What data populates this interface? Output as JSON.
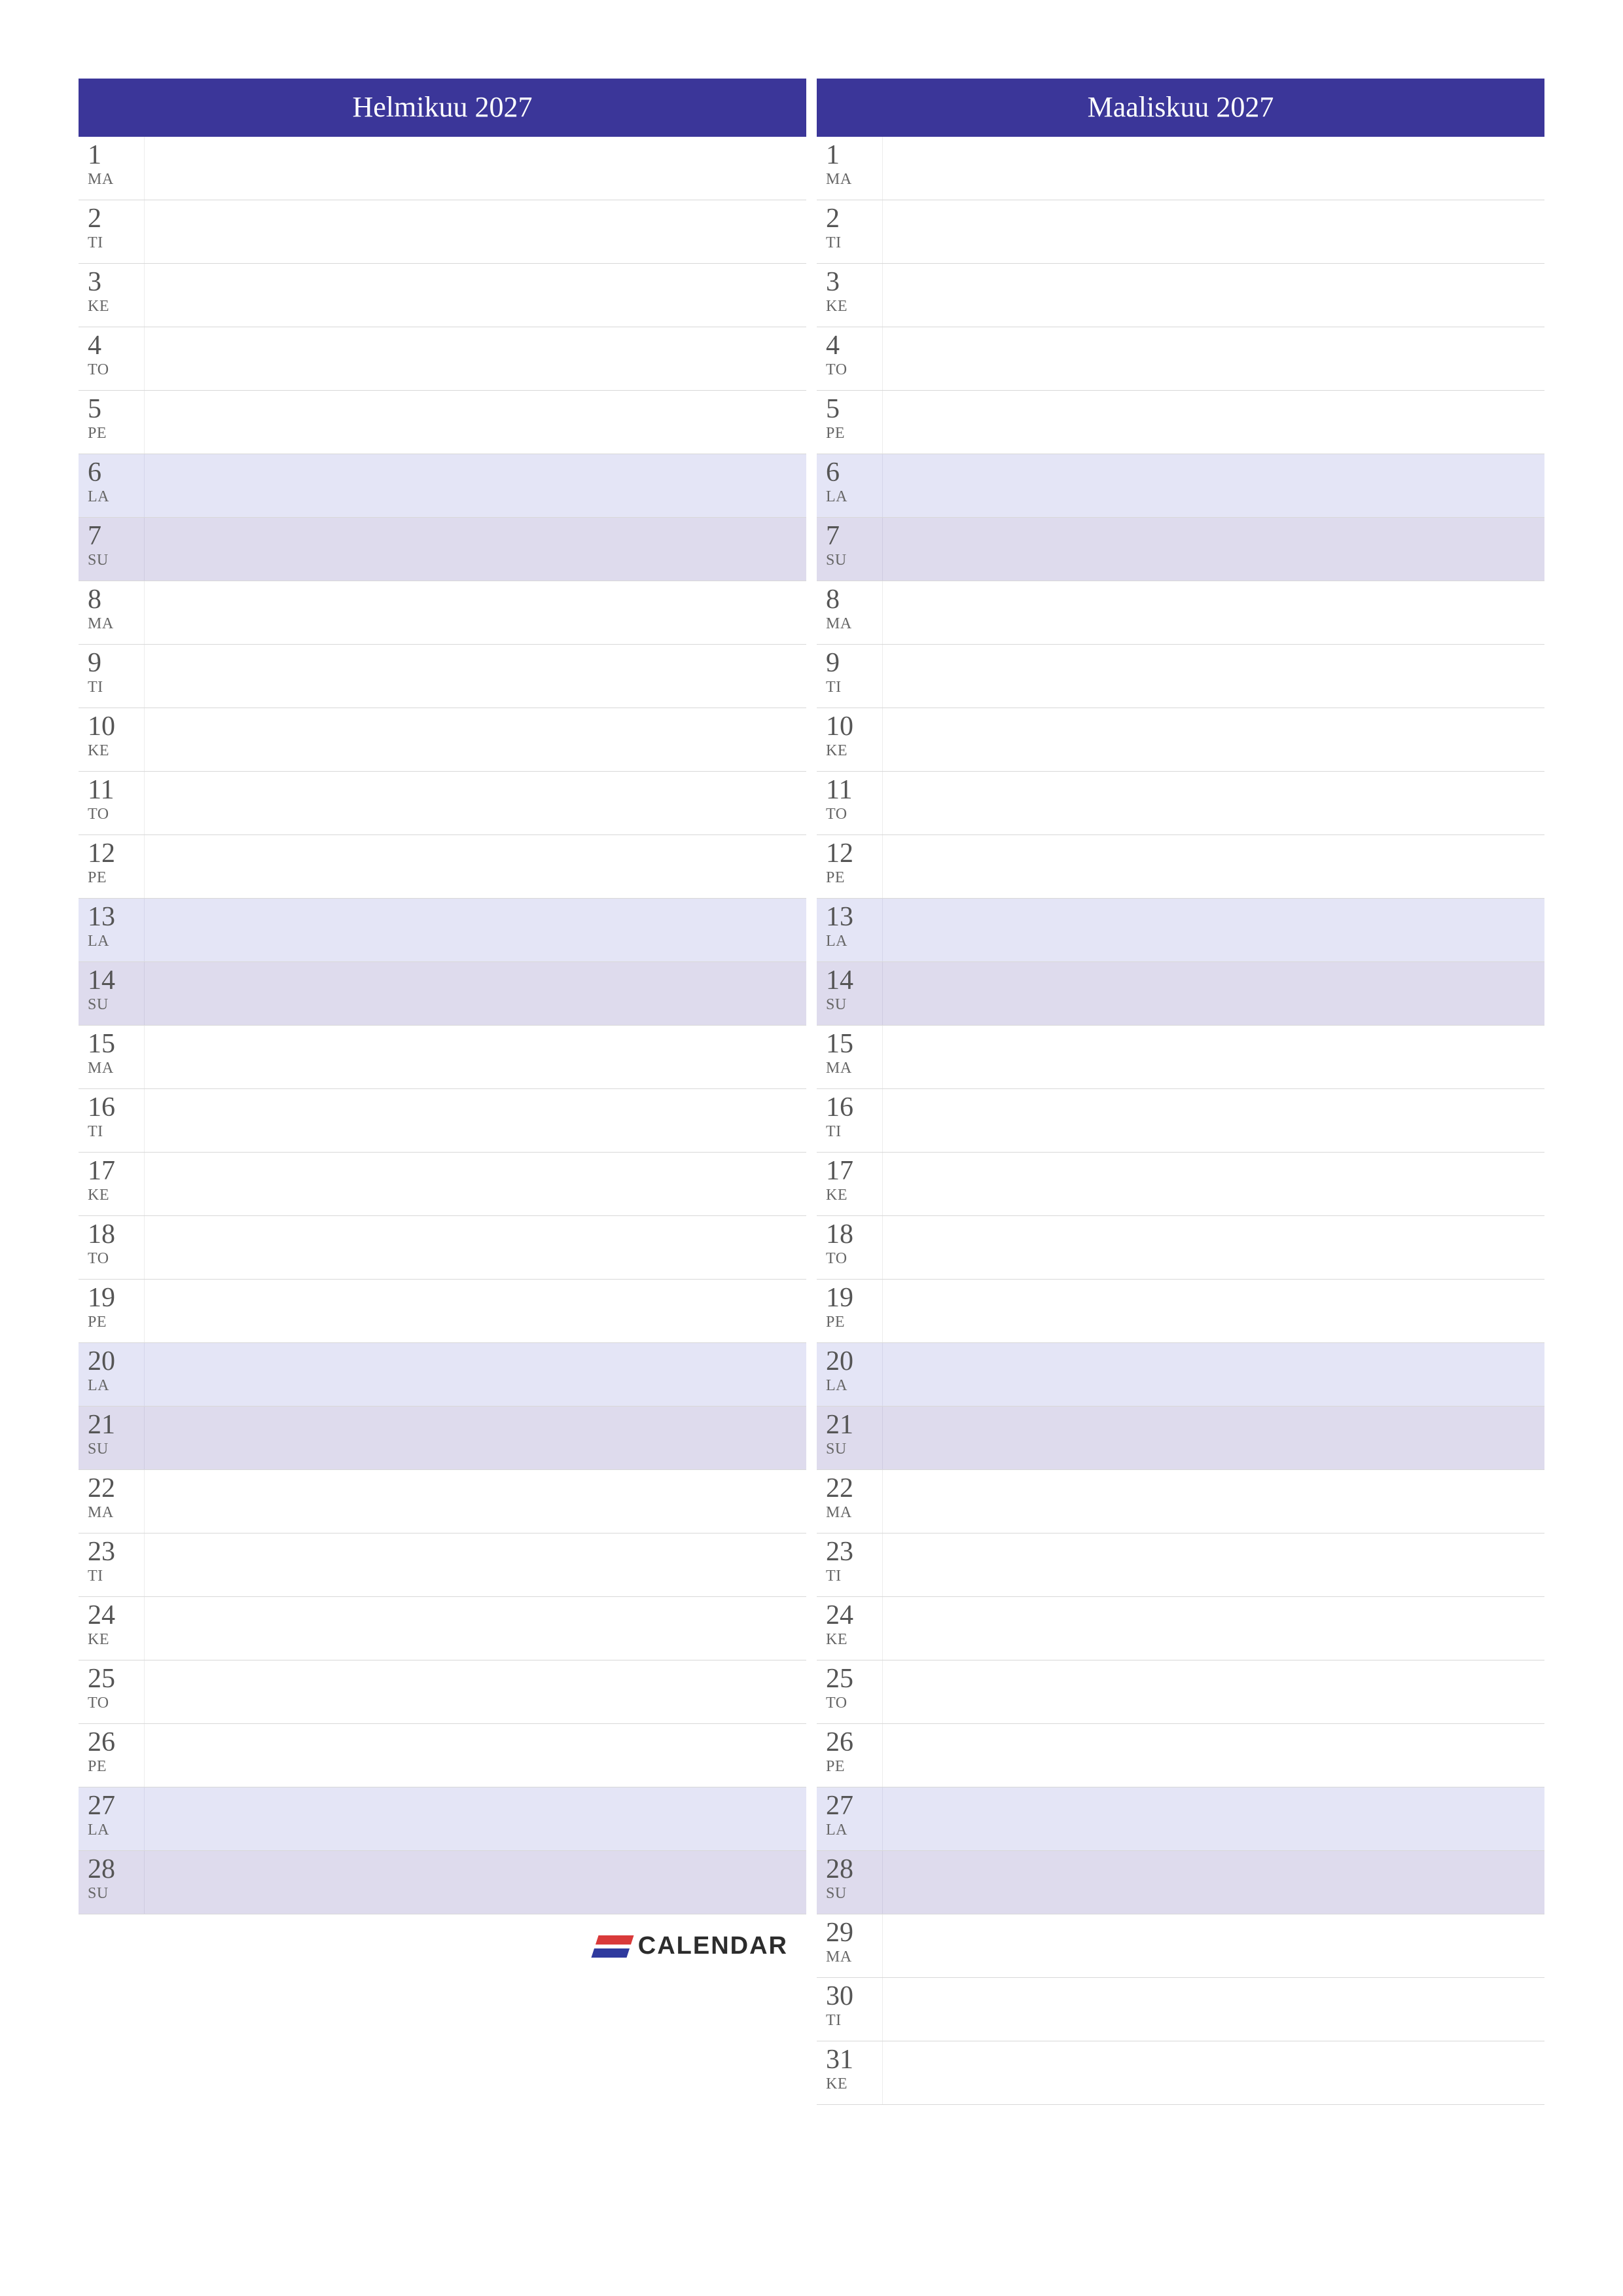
{
  "logo_text": "CALENDAR",
  "day_abbrs": [
    "MA",
    "TI",
    "KE",
    "TO",
    "PE",
    "LA",
    "SU"
  ],
  "months": [
    {
      "title": "Helmikuu 2027",
      "days_in_month": 28,
      "start_dow": 0
    },
    {
      "title": "Maaliskuu 2027",
      "days_in_month": 31,
      "start_dow": 0
    }
  ],
  "colors": {
    "header_bg": "#3b3699",
    "saturday_bg": "#e4e5f6",
    "sunday_bg": "#dedbed"
  }
}
